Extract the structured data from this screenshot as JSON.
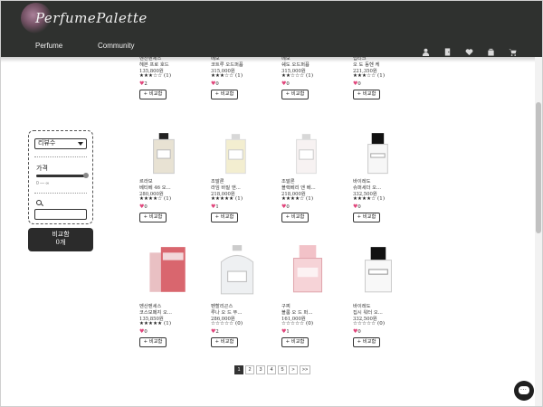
{
  "header": {
    "logo": "PerfumePalette",
    "nav": {
      "perfume": "Perfume",
      "community": "Community"
    },
    "icons": [
      "user-icon",
      "door-icon",
      "heart-icon",
      "bag-icon",
      "cart-icon"
    ]
  },
  "sidebar": {
    "sort_value": "리뷰수",
    "price_label": "가격",
    "price_range": "0 — ∞",
    "compare_label": "비교함",
    "compare_count": "0개"
  },
  "compare_button_label": "+ 비교함",
  "products_top": [
    {
      "brand": "멘산멘세스",
      "name": "헤븐 프로 호드",
      "price": "135,800원",
      "stars": "★★★☆☆",
      "reviews": "(1)",
      "likes": "2"
    },
    {
      "brand": "메모",
      "name": "코트루 오드퍼퓸",
      "price": "315,000원",
      "stars": "★★★☆☆",
      "reviews": "(1)",
      "likes": "0"
    },
    {
      "brand": "메모",
      "name": "쉐도 오드퍼퓸",
      "price": "315,000원",
      "stars": "★★☆☆☆",
      "reviews": "(1)",
      "likes": "0"
    },
    {
      "brand": "딥티크",
      "name": "오 도 동헨 케",
      "price": "221,350원",
      "stars": "★★★☆☆",
      "reviews": "(1)",
      "likes": "0"
    }
  ],
  "products_mid": [
    {
      "brand": "르라보",
      "name": "베티베 46 오...",
      "price": "280,000원",
      "stars": "★★★★☆",
      "reviews": "(1)",
      "likes": "0"
    },
    {
      "brand": "조말론",
      "name": "라임 바질 앤...",
      "price": "218,000원",
      "stars": "★★★★★",
      "reviews": "(1)",
      "likes": "1"
    },
    {
      "brand": "조말론",
      "name": "블랙베리 앤 베...",
      "price": "218,000원",
      "stars": "★★★★☆",
      "reviews": "(1)",
      "likes": "0"
    },
    {
      "brand": "바이레도",
      "name": "슈퍼세더 오...",
      "price": "332,500원",
      "stars": "★★★★☆",
      "reviews": "(1)",
      "likes": "0"
    }
  ],
  "products_bottom": [
    {
      "brand": "멘산멘세스",
      "name": "코스모페지 오...",
      "price": "135,850원",
      "stars": "★★★★★",
      "reviews": "(1)",
      "likes": "0"
    },
    {
      "brand": "펜할리곤스",
      "name": "루나 오 드 뚜...",
      "price": "286,000원",
      "stars": "☆☆☆☆☆",
      "reviews": "(0)",
      "likes": "2"
    },
    {
      "brand": "구찌",
      "name": "블룸 오 드 퍼...",
      "price": "161,000원",
      "stars": "☆☆☆☆☆",
      "reviews": "(0)",
      "likes": "1"
    },
    {
      "brand": "바이레도",
      "name": "집시 워터 오...",
      "price": "332,500원",
      "stars": "☆☆☆☆☆",
      "reviews": "(0)",
      "likes": "0"
    }
  ],
  "pagination": [
    "1",
    "2",
    "3",
    "4",
    "5",
    ">",
    ">>"
  ],
  "pagination_active": "1"
}
